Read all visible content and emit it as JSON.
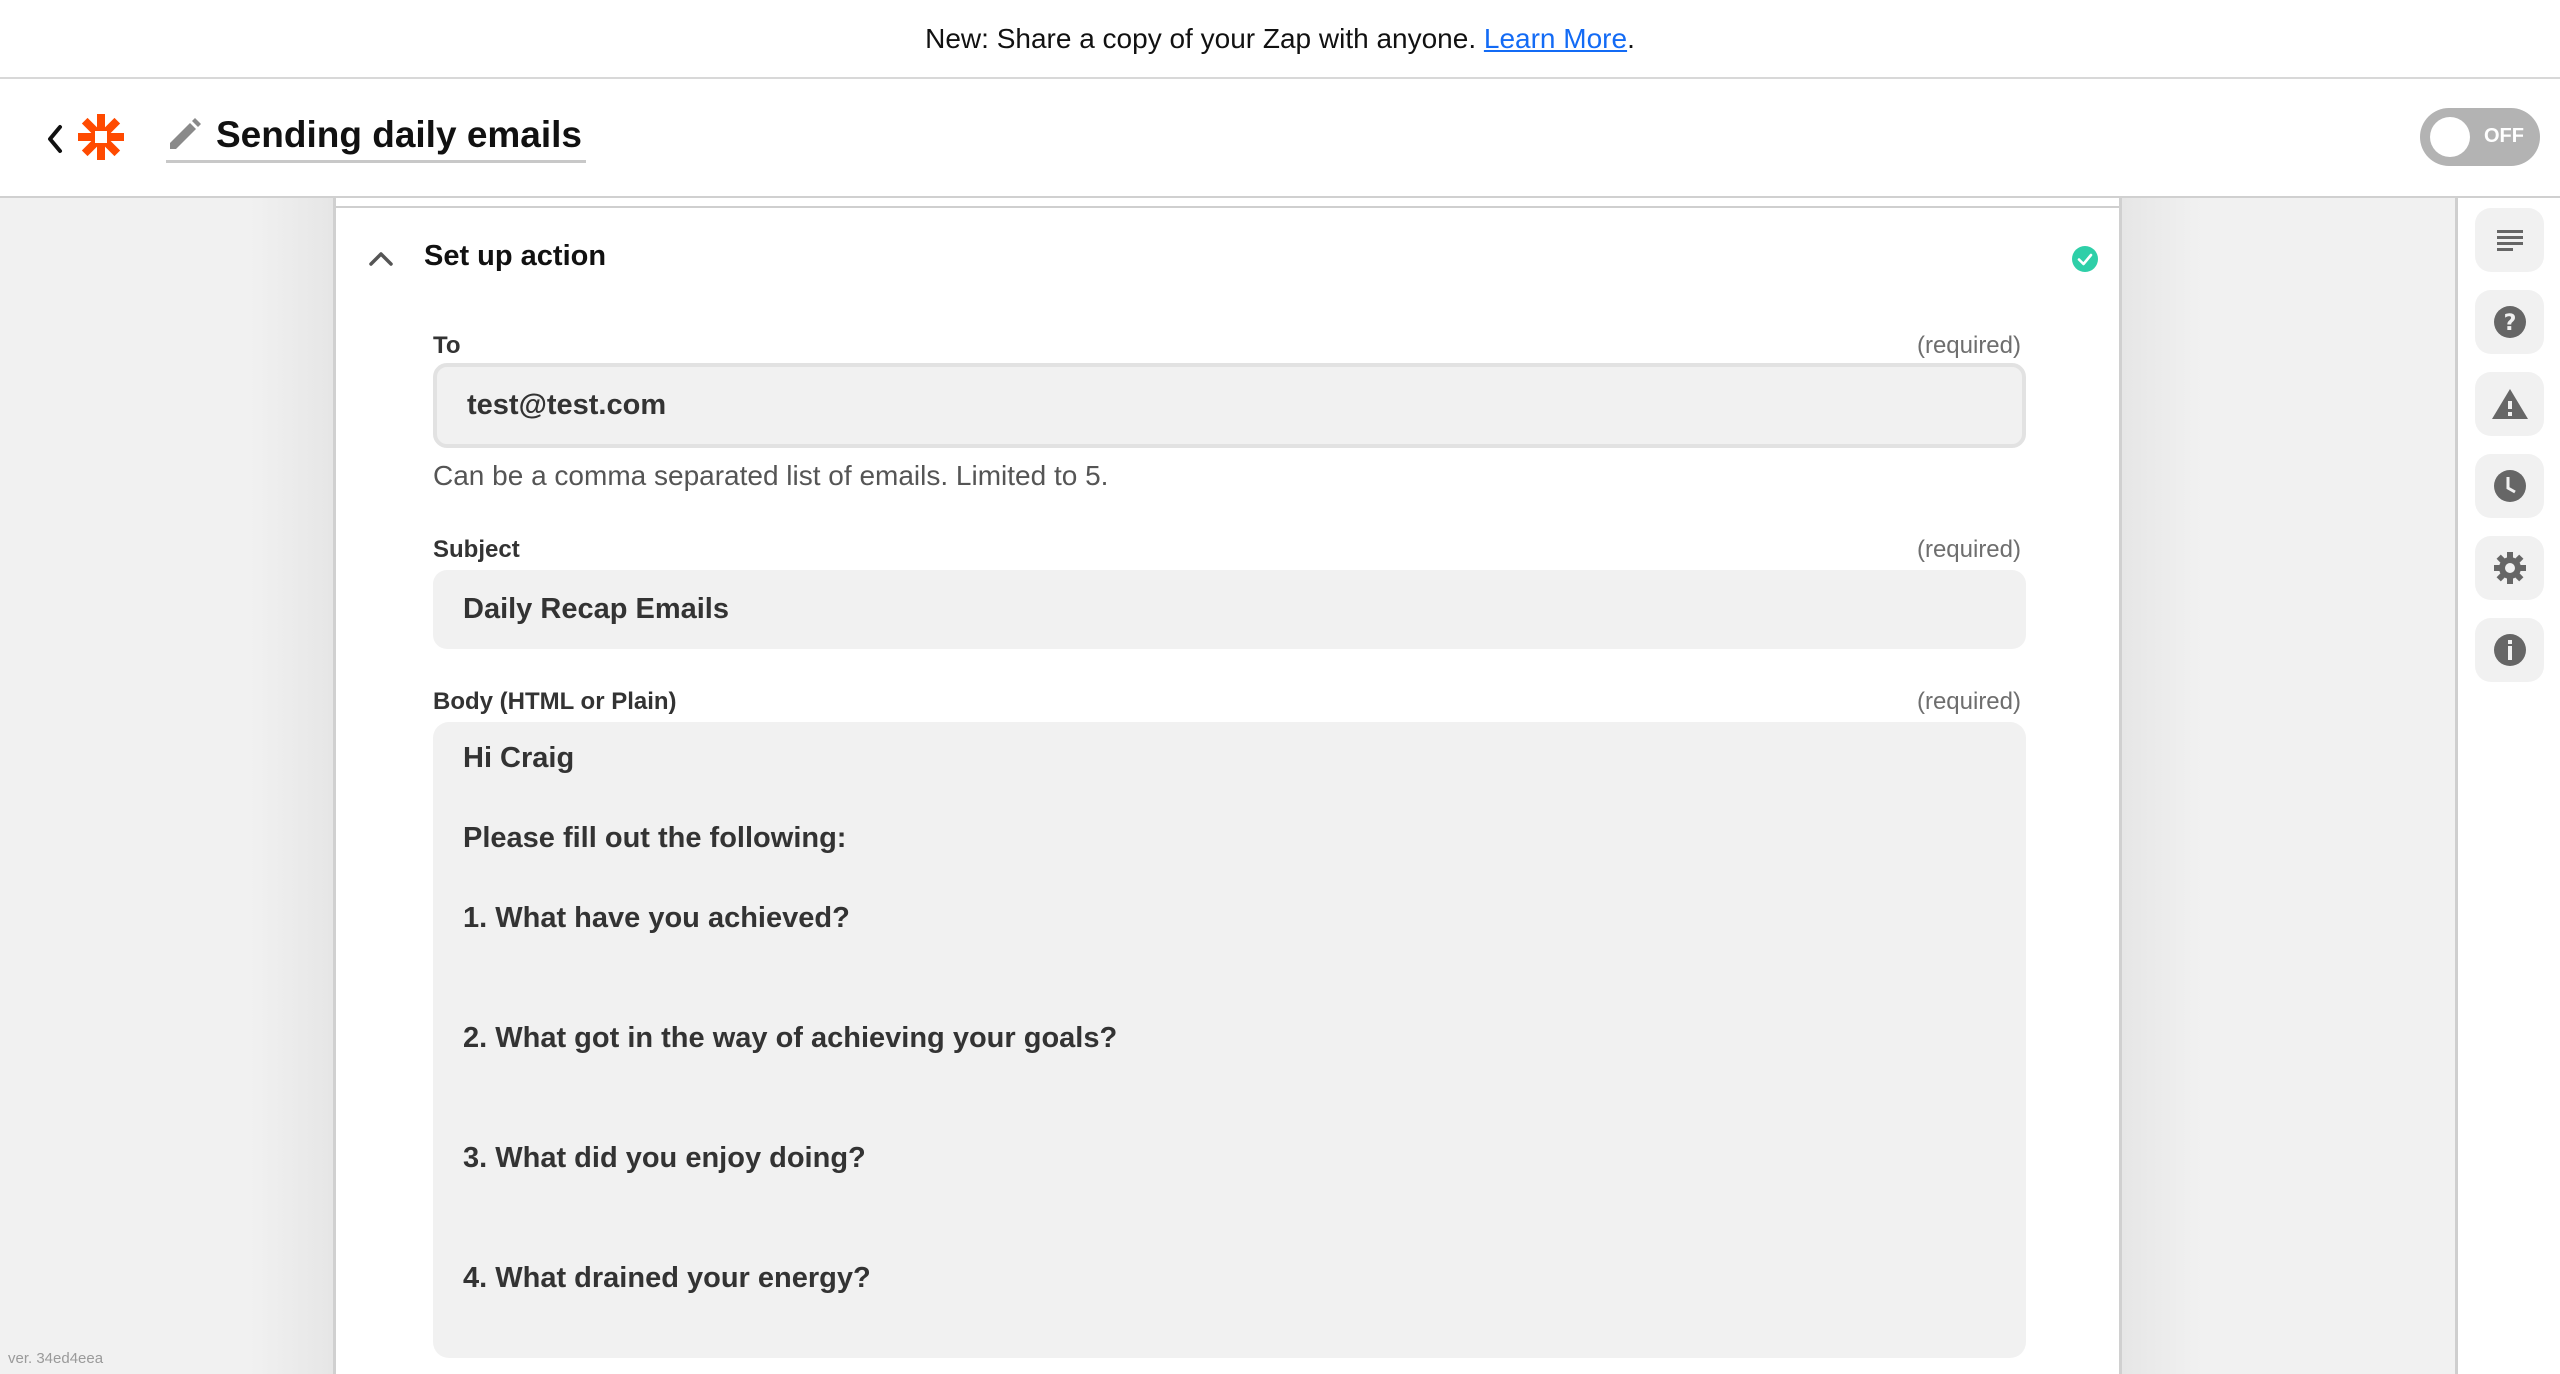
{
  "banner": {
    "text": "New: Share a copy of your Zap with anyone. ",
    "link_label": "Learn More",
    "suffix": "."
  },
  "header": {
    "back_icon": "chevron-left-icon",
    "logo_icon": "zapier-logo-icon",
    "edit_icon": "pencil-icon",
    "title": "Sending daily emails",
    "toggle": {
      "state": "off",
      "label": "OFF"
    }
  },
  "section": {
    "title": "Set up action",
    "collapse_icon": "chevron-up-icon",
    "status_icon": "check-circle-icon",
    "status_color": "#2ecfa8"
  },
  "fields": {
    "to": {
      "label": "To",
      "required": "(required)",
      "value": "test@test.com",
      "help": "Can be a comma separated list of emails. Limited to 5."
    },
    "subject": {
      "label": "Subject",
      "required": "(required)",
      "value": "Daily Recap Emails"
    },
    "body": {
      "label": "Body (HTML or Plain)",
      "required": "(required)",
      "lines": [
        "Hi Craig",
        "",
        "Please fill out the following:",
        "",
        "1. What have you achieved?",
        "",
        "",
        "2. What got in the way of achieving your goals?",
        "",
        "",
        "3. What did you enjoy doing?",
        "",
        "",
        "4. What drained your energy?"
      ]
    }
  },
  "sidebar": {
    "items": [
      {
        "name": "outline",
        "icon": "list-lines-icon"
      },
      {
        "name": "help",
        "icon": "question-circle-icon"
      },
      {
        "name": "alerts",
        "icon": "warning-triangle-icon"
      },
      {
        "name": "history",
        "icon": "clock-icon"
      },
      {
        "name": "settings",
        "icon": "gear-icon"
      },
      {
        "name": "details",
        "icon": "info-circle-icon"
      }
    ]
  },
  "footer": {
    "version": "ver. 34ed4eea"
  }
}
